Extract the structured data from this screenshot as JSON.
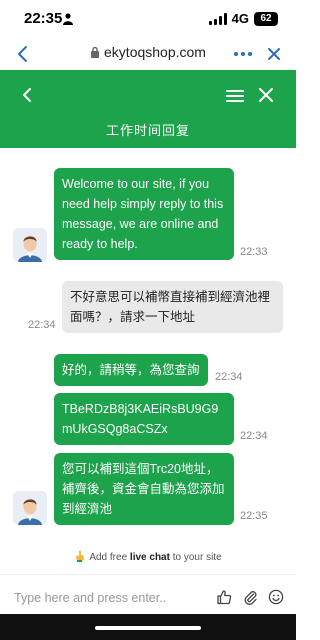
{
  "status_bar": {
    "time": "22:35",
    "network": "4G",
    "battery": "62"
  },
  "browser": {
    "url": "ekytoqshop.com"
  },
  "chat": {
    "title": "工作时间回复",
    "messages": [
      {
        "from": "agent",
        "text": "Welcome to our site, if you need help simply reply to this message, we are online and ready to help.",
        "time": "22:33"
      },
      {
        "from": "visitor",
        "text": "不好意思可以補幣直接補到經濟池裡面嗎？，請求一下地址",
        "time": "22:34"
      },
      {
        "from": "agent",
        "text": "好的，請稍等，為您查詢",
        "time": "22:34"
      },
      {
        "from": "agent",
        "text": "TBeRDzB8j3KAEiRsBU9G9mUkGSQg8aCSZx",
        "time": "22:34"
      },
      {
        "from": "agent",
        "text": "您可以補到這個Trc20地址，補齊後，資金會自動為您添加到經濟池",
        "time": "22:35"
      }
    ]
  },
  "footer": {
    "powered_prefix": "Add free",
    "powered_bold": "live chat",
    "powered_suffix": "to your site",
    "input_placeholder": "Type here and press enter.."
  },
  "colors": {
    "accent": "#1da34b",
    "visitor_bubble": "#e9e9e9"
  }
}
